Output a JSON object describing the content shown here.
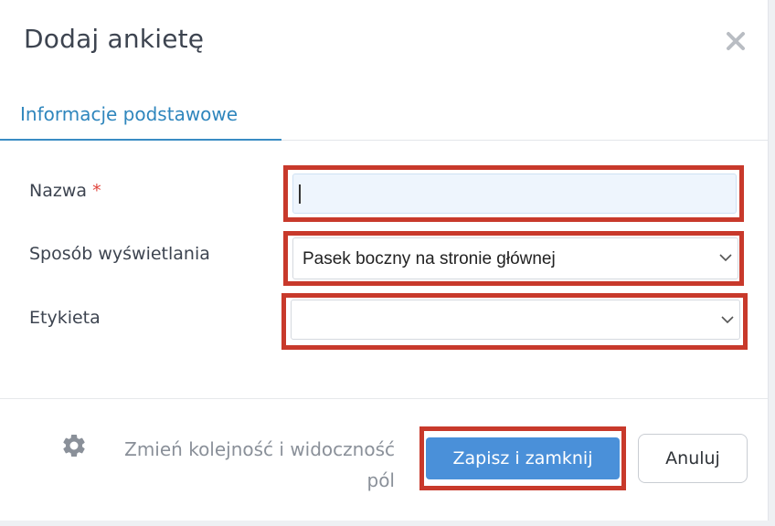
{
  "dialog": {
    "title": "Dodaj ankietę"
  },
  "tabs": [
    {
      "label": "Informacje podstawowe",
      "active": true
    }
  ],
  "form": {
    "name": {
      "label": "Nazwa",
      "required_marker": "*",
      "value": ""
    },
    "display_mode": {
      "label": "Sposób wyświetlania",
      "value": "Pasek boczny na stronie głównej"
    },
    "tag": {
      "label": "Etykieta",
      "value": ""
    }
  },
  "footer": {
    "reorder_label_line1": "Zmień kolejność i widoczność",
    "reorder_label_line2": "pól",
    "save_label": "Zapisz i zamknij",
    "cancel_label": "Anuluj"
  },
  "colors": {
    "accent": "#2f86bd",
    "primary_button": "#4a90d9",
    "highlight": "#c8392b",
    "required": "#e0433b"
  },
  "icons": {
    "close": "close-icon",
    "gear": "gear-icon",
    "chevron": "chevron-down-icon"
  }
}
